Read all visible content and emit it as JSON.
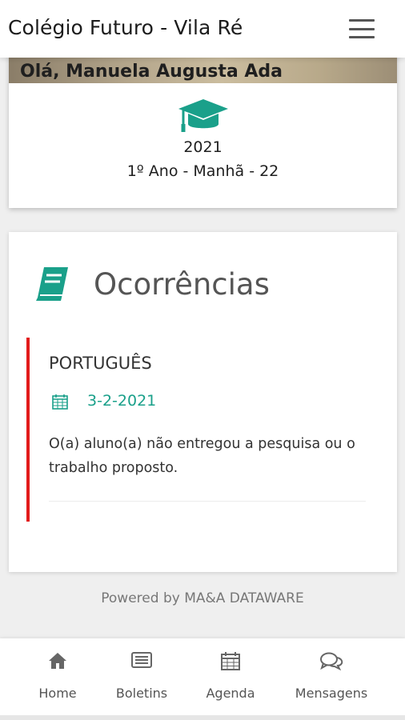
{
  "header": {
    "title": "Colégio Futuro - Vila Ré",
    "menu_icon": "hamburger-menu-icon"
  },
  "profile": {
    "greeting": "Olá, Manuela Augusta Ada",
    "icon": "graduation-cap-icon",
    "year": "2021",
    "class_info": "1º Ano - Manhã - 22"
  },
  "occurrences": {
    "title": "Ocorrências",
    "icon": "book-icon",
    "items": [
      {
        "subject": "PORTUGUÊS",
        "date": "3-2-2021",
        "description": "O(a) aluno(a) não entregou a pesquisa ou o trabalho proposto."
      }
    ]
  },
  "footer": {
    "powered_by": "Powered by MA&A DATAWARE"
  },
  "bottom_nav": [
    {
      "label": "Home",
      "icon": "home-icon"
    },
    {
      "label": "Boletins",
      "icon": "report-icon"
    },
    {
      "label": "Agenda",
      "icon": "calendar-icon"
    },
    {
      "label": "Mensagens",
      "icon": "chat-icon"
    }
  ],
  "colors": {
    "accent": "#1aa08a",
    "alert": "#e21b1b"
  }
}
